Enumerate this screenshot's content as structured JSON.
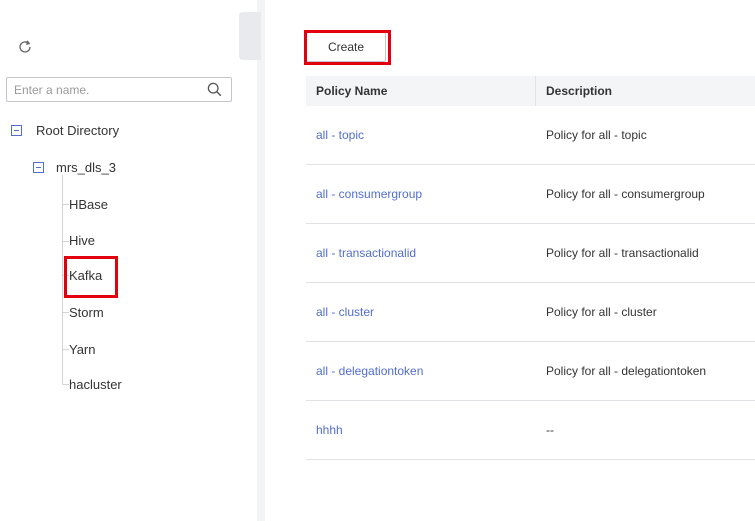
{
  "tree": {
    "search_placeholder": "Enter a name.",
    "root_label": "Root Directory",
    "cluster_label": "mrs_dls_3",
    "services": [
      "HBase",
      "Hive",
      "Kafka",
      "Storm",
      "Yarn",
      "hacluster"
    ],
    "selected": "Kafka"
  },
  "toolbar": {
    "create_label": "Create"
  },
  "table": {
    "columns": [
      "Policy Name",
      "Description"
    ],
    "rows": [
      {
        "name": "all - topic",
        "description": "Policy for all - topic"
      },
      {
        "name": "all - consumergroup",
        "description": "Policy for all - consumergroup"
      },
      {
        "name": "all - transactionalid",
        "description": "Policy for all - transactionalid"
      },
      {
        "name": "all - cluster",
        "description": "Policy for all - cluster"
      },
      {
        "name": "all - delegationtoken",
        "description": "Policy for all - delegationtoken"
      },
      {
        "name": "hhhh",
        "description": "--"
      }
    ]
  },
  "colors": {
    "link": "#526ecc",
    "highlight_border": "#e2000f",
    "header_bg": "#f4f5f7"
  },
  "icons": [
    "refresh-icon",
    "search-icon",
    "collapse-icon"
  ]
}
